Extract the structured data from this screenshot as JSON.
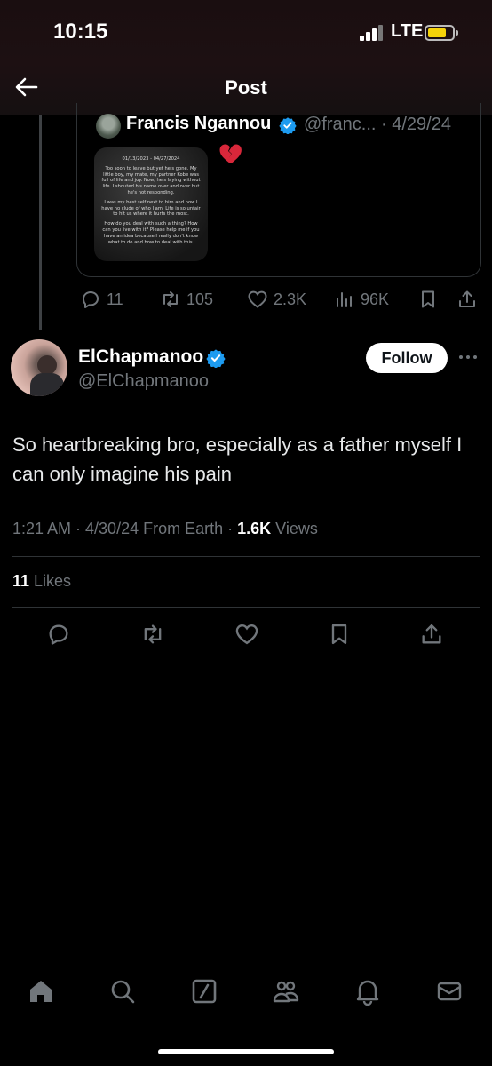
{
  "status_bar": {
    "time": "10:15",
    "network": "LTE",
    "battery_color": "#f5d30a"
  },
  "header": {
    "title": "Post",
    "back_icon": "arrow-left-icon"
  },
  "quoted_post": {
    "author_name": "Francis Ngannou",
    "handle_and_date": "@franc... · 4/29/24",
    "emoji": "broken-heart",
    "image_text": {
      "date_range": "01/13/2023 - 04/27/2024",
      "paragraph_1": "Too soon to leave but yet he's gone. My little boy, my mate, my partner Kobe was full of life and joy. Now, he's laying without life. I shouted his name over and over but he's not responding.",
      "paragraph_2": "I was my best self next to him and now I have no clude of who I am. Life is so unfair to hit us where it hurts the most.",
      "paragraph_3": "How do you deal with such a thing? How can you live with it? Please help me if you have an idea because I really don't know what to do and how to deal with this."
    },
    "stats": {
      "replies": "11",
      "reposts": "105",
      "likes": "2.3K",
      "views": "96K"
    }
  },
  "reply": {
    "author_name": "ElChapmanoo",
    "handle": "@ElChapmanoo",
    "follow_label": "Follow",
    "text": "So heartbreaking bro, especially as a father myself I can only imagine his pain",
    "time_date": "1:21 AM · 4/30/24 From Earth · ",
    "views_count": "1.6K",
    "views_label": " Views",
    "likes_count": "11",
    "likes_label": " Likes"
  },
  "colors": {
    "accent_blue": "#1d9bf0",
    "muted": "#71767b",
    "background": "#000000"
  },
  "bottom_nav": [
    "home-icon",
    "search-icon",
    "grok-icon",
    "communities-icon",
    "notifications-icon",
    "messages-icon"
  ]
}
